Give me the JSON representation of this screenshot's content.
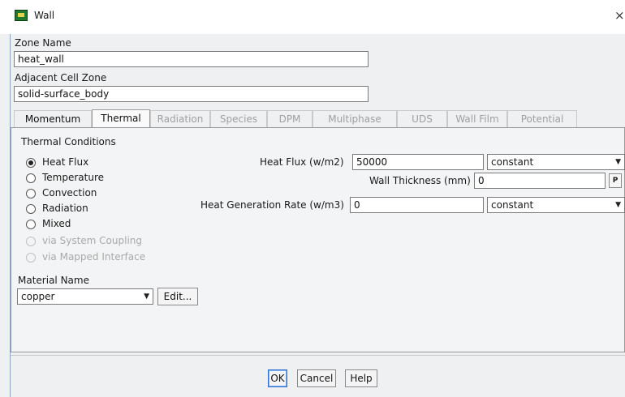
{
  "window": {
    "title": "Wall",
    "close_glyph": "×",
    "icon": "fluent-app-icon"
  },
  "zone_name": {
    "label": "Zone Name",
    "value": "heat_wall"
  },
  "adjacent_cell_zone": {
    "label": "Adjacent Cell Zone",
    "value": "solid-surface_body"
  },
  "tabs": [
    {
      "label": "Momentum",
      "state": "enabled"
    },
    {
      "label": "Thermal",
      "state": "active"
    },
    {
      "label": "Radiation",
      "state": "disabled"
    },
    {
      "label": "Species",
      "state": "disabled"
    },
    {
      "label": "DPM",
      "state": "disabled"
    },
    {
      "label": "Multiphase",
      "state": "disabled"
    },
    {
      "label": "UDS",
      "state": "disabled"
    },
    {
      "label": "Wall Film",
      "state": "disabled"
    },
    {
      "label": "Potential",
      "state": "disabled"
    }
  ],
  "thermal_conditions": {
    "title": "Thermal Conditions",
    "options": [
      {
        "label": "Heat Flux",
        "checked": true,
        "enabled": true
      },
      {
        "label": "Temperature",
        "checked": false,
        "enabled": true
      },
      {
        "label": "Convection",
        "checked": false,
        "enabled": true
      },
      {
        "label": "Radiation",
        "checked": false,
        "enabled": true
      },
      {
        "label": "Mixed",
        "checked": false,
        "enabled": true
      },
      {
        "label": "via System Coupling",
        "checked": false,
        "enabled": false
      },
      {
        "label": "via Mapped Interface",
        "checked": false,
        "enabled": false
      }
    ]
  },
  "heat_flux": {
    "label": "Heat Flux (w/m2)",
    "value": "50000",
    "method": "constant"
  },
  "wall_thickness": {
    "label": "Wall Thickness (mm)",
    "value": "0",
    "param_button": "P"
  },
  "heat_generation": {
    "label": "Heat Generation Rate (w/m3)",
    "value": "0",
    "method": "constant"
  },
  "material": {
    "label": "Material Name",
    "value": "copper",
    "edit_label": "Edit..."
  },
  "buttons": {
    "ok": "OK",
    "cancel": "Cancel",
    "help": "Help"
  },
  "colors": {
    "accent": "#2a6fd1",
    "panel_bg": "#f3f4f5",
    "disabled_text": "#a0a0a0"
  }
}
